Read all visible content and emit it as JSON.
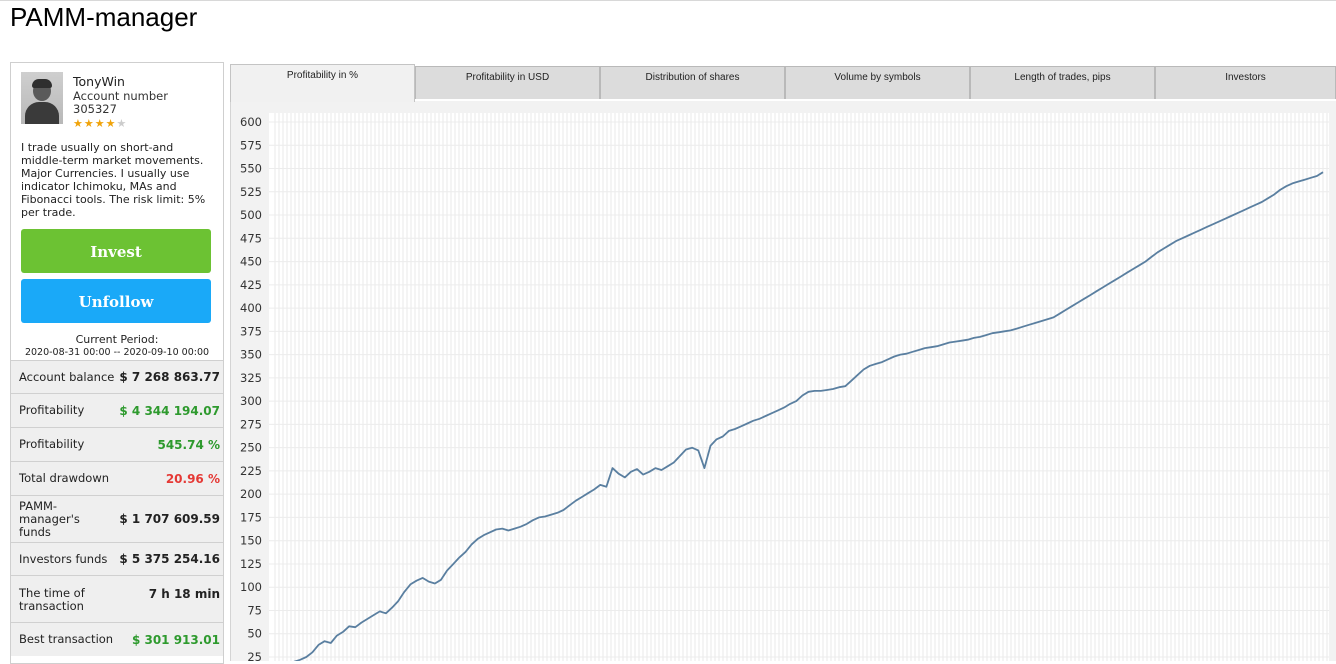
{
  "page": {
    "title": "PAMM-manager"
  },
  "manager": {
    "name": "TonyWin",
    "account_label": "Account number",
    "account_number": "305327",
    "rating_stars": 4,
    "rating_max": 5,
    "description": "I trade usually on short-and middle-term market movements. Major Currencies. I usually use indicator Ichimoku, MAs and Fibonacci tools. The risk limit: 5% per trade."
  },
  "actions": {
    "invest_label": "Invest",
    "unfollow_label": "Unfollow"
  },
  "period": {
    "label": "Current Period:",
    "range": "2020-08-31 00:00 -- 2020-09-10 00:00"
  },
  "stats": [
    {
      "label": "Account balance",
      "value": "$ 7 268 863.77",
      "tone": "dark"
    },
    {
      "label": "Profitability",
      "value": "$ 4 344 194.07",
      "tone": "green"
    },
    {
      "label": "Profitability",
      "value": "545.74 %",
      "tone": "green"
    },
    {
      "label": "Total drawdown",
      "value": "20.96 %",
      "tone": "red"
    },
    {
      "label": "PAMM-manager's funds",
      "value": "$ 1 707 609.59",
      "tone": "dark"
    },
    {
      "label": "Investors funds",
      "value": "$ 5 375 254.16",
      "tone": "dark"
    },
    {
      "label": "The time of transaction",
      "value": "7 h 18 min",
      "tone": "dark"
    },
    {
      "label": "Best transaction",
      "value": "$ 301 913.01",
      "tone": "green"
    }
  ],
  "tabs": [
    {
      "label": "Profitability in %",
      "active": true
    },
    {
      "label": "Profitability in USD",
      "active": false
    },
    {
      "label": "Distribution of shares",
      "active": false
    },
    {
      "label": "Volume by symbols",
      "active": false
    },
    {
      "label": "Length of trades, pips",
      "active": false
    },
    {
      "label": "Investors",
      "active": false
    }
  ],
  "colors": {
    "invest": "#6cc233",
    "unfollow": "#1aa9f8",
    "line": "#5a7fa0",
    "positive": "#2e9a2e",
    "negative": "#e53935"
  },
  "chart_data": {
    "type": "line",
    "title": "",
    "xlabel": "",
    "ylabel": "",
    "ylim": [
      25,
      600
    ],
    "yticks": [
      600,
      575,
      550,
      525,
      500,
      475,
      450,
      425,
      400,
      375,
      350,
      325,
      300,
      275,
      250,
      225,
      200,
      175,
      150,
      125,
      100,
      75,
      50,
      25
    ],
    "grid": true,
    "series": [
      {
        "values": [
          20,
          22,
          25,
          30,
          38,
          42,
          40,
          48,
          52,
          58,
          57,
          62,
          66,
          70,
          74,
          72,
          78,
          85,
          95,
          103,
          107,
          110,
          106,
          104,
          108,
          118,
          125,
          132,
          138,
          146,
          152,
          156,
          159,
          162,
          163,
          161,
          163,
          165,
          168,
          172,
          175,
          176,
          178,
          180,
          183,
          188,
          193,
          197,
          201,
          205,
          210,
          208,
          228,
          222,
          218,
          224,
          227,
          221,
          224,
          228,
          226,
          230,
          234,
          241,
          248,
          250,
          247,
          228,
          252,
          259,
          262,
          268,
          270,
          273,
          276,
          279,
          281,
          284,
          287,
          290,
          293,
          297,
          300,
          306,
          310,
          311,
          311,
          312,
          313,
          315,
          316,
          322,
          328,
          334,
          338,
          340,
          342,
          345,
          348,
          350,
          351,
          353,
          355,
          357,
          358,
          359,
          361,
          363,
          364,
          365,
          366,
          368,
          369,
          371,
          373,
          374,
          375,
          376,
          378,
          380,
          382,
          384,
          386,
          388,
          390,
          394,
          398,
          402,
          406,
          410,
          414,
          418,
          422,
          426,
          430,
          434,
          438,
          442,
          446,
          450,
          455,
          460,
          464,
          468,
          472,
          475,
          478,
          481,
          484,
          487,
          490,
          493,
          496,
          499,
          502,
          505,
          508,
          511,
          514,
          518,
          522,
          527,
          531,
          534,
          536,
          538,
          540,
          542,
          546
        ]
      }
    ]
  }
}
